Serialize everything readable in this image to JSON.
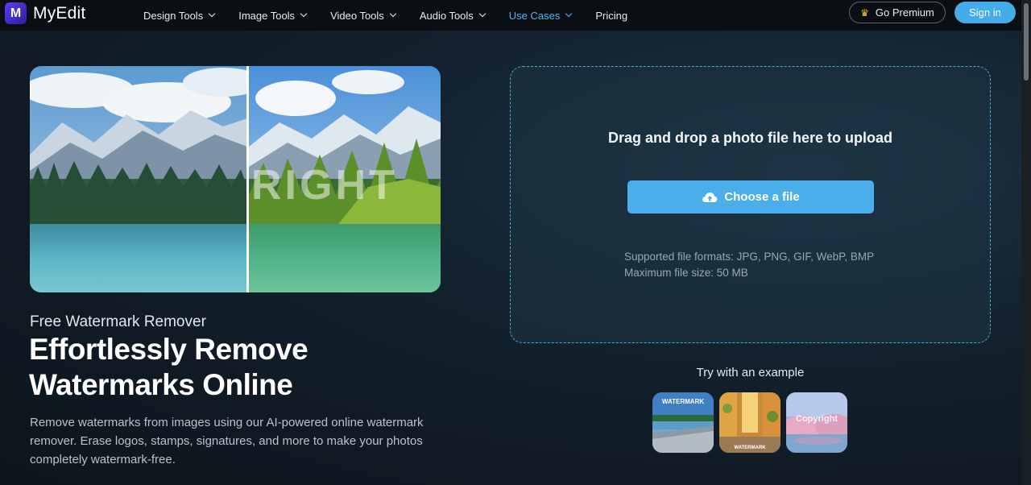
{
  "brand": {
    "logo_letter": "M",
    "name": "MyEdit"
  },
  "nav": {
    "items": [
      {
        "label": "Design Tools",
        "has_dropdown": true
      },
      {
        "label": "Image Tools",
        "has_dropdown": true
      },
      {
        "label": "Video Tools",
        "has_dropdown": true
      },
      {
        "label": "Audio Tools",
        "has_dropdown": true
      },
      {
        "label": "Use Cases",
        "has_dropdown": true,
        "active": true
      },
      {
        "label": "Pricing",
        "has_dropdown": false
      }
    ],
    "premium_label": "Go Premium",
    "premium_icon": "crown-icon",
    "signin_label": "Sign in"
  },
  "hero": {
    "image_watermark_text": "RIGHT",
    "eyebrow": "Free Watermark Remover",
    "headline_line1": "Effortlessly Remove",
    "headline_line2": "Watermarks Online",
    "description": "Remove watermarks from images using our AI-powered online watermark remover. Erase logos, stamps, signatures, and more to make your photos completely watermark-free."
  },
  "upload": {
    "title": "Drag and drop a photo file here to upload",
    "button_label": "Choose a file",
    "button_icon": "cloud-upload-icon",
    "formats": "Supported file formats: JPG, PNG, GIF, WebP, BMP",
    "max_size": "Maximum file size: 50 MB"
  },
  "examples": {
    "label": "Try with an example",
    "items": [
      {
        "watermark": "WATERMARK"
      },
      {
        "watermark": "WATERMARK"
      },
      {
        "watermark": "Copyright"
      }
    ]
  },
  "colors": {
    "accent": "#45acec",
    "active_nav": "#53b6f2",
    "nav_bg": "#0b0f14",
    "crown": "#f4c430"
  }
}
